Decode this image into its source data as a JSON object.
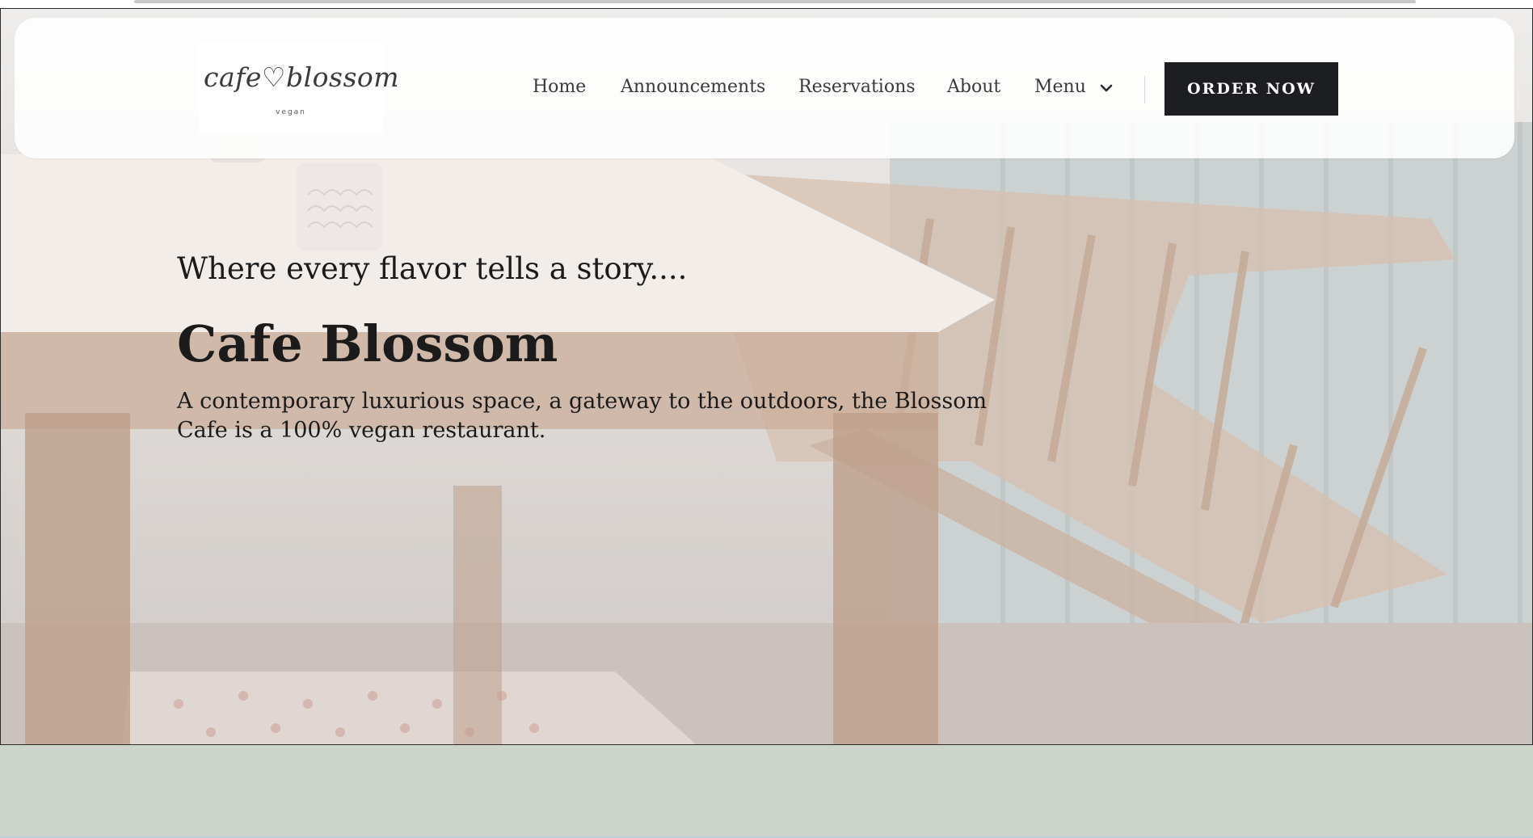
{
  "logo": {
    "script_text": "cafe♡blossom",
    "subtext": "vegan"
  },
  "nav": {
    "items": [
      "Home",
      "Announcements",
      "Reservations",
      "About"
    ],
    "menu_label": "Menu",
    "order_button": "ORDER NOW"
  },
  "hero": {
    "tagline": "Where every flavor tells a story....",
    "title": "Cafe Blossom",
    "description": "A contemporary luxurious space, a gateway to the outdoors, the Blossom Cafe is a 100% vegan restaurant."
  },
  "icons": {
    "menu_chevron": "chevron-down-icon"
  },
  "colors": {
    "button_bg": "#1d1e22",
    "band": "#cdd5cb",
    "text": "#1b1b1b"
  }
}
